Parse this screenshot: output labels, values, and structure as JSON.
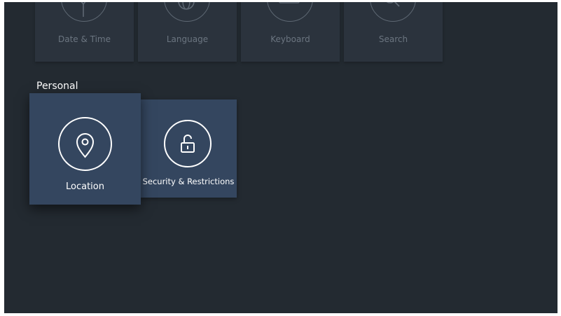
{
  "top_row": [
    {
      "label": "Date & Time",
      "icon": "antenna-icon"
    },
    {
      "label": "Language",
      "icon": "globe-icon"
    },
    {
      "label": "Keyboard",
      "icon": "keyboard-icon"
    },
    {
      "label": "Search",
      "icon": "search-icon"
    }
  ],
  "personal": {
    "title": "Personal",
    "items": [
      {
        "label": "Location",
        "icon": "location-pin-icon",
        "focused": true
      },
      {
        "label": "Security & Restrictions",
        "icon": "unlocked-padlock-icon",
        "focused": false
      }
    ]
  },
  "colors": {
    "background": "#232a31",
    "tile": "#2b333d",
    "tile_selected": "#34465f",
    "text_dim": "#6b7580",
    "text_bright": "#ffffff"
  }
}
